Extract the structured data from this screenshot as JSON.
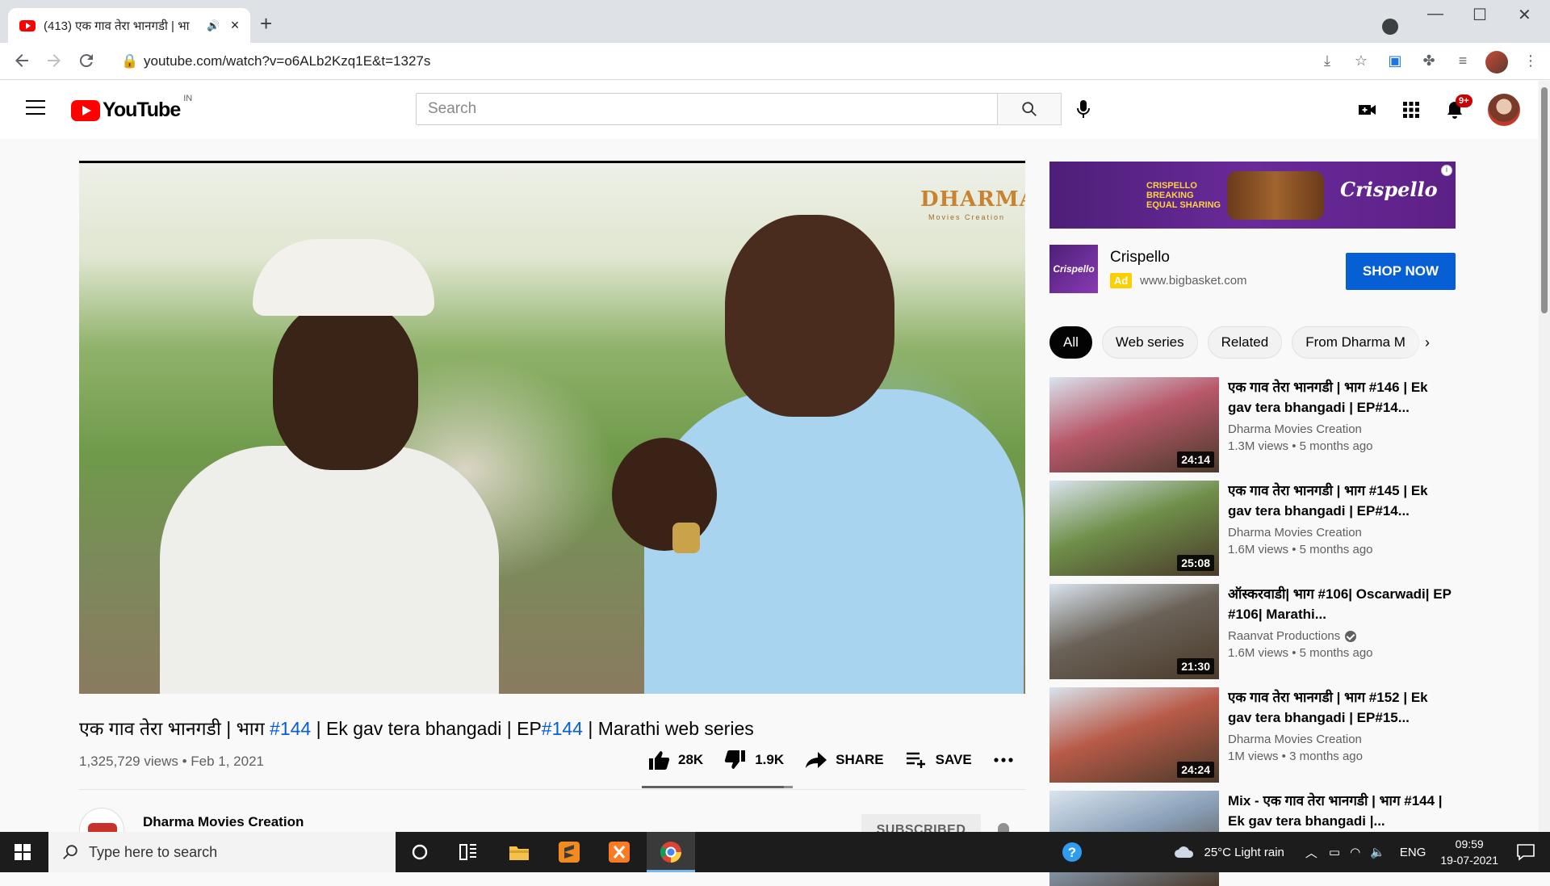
{
  "browser": {
    "tab_title": "(413) एक गाव तेरा भानगडी | भा",
    "url": "youtube.com/watch?v=o6ALb2Kzq1E&t=1327s"
  },
  "youtube": {
    "country_code": "IN",
    "search_placeholder": "Search",
    "notification_count": "9+"
  },
  "video": {
    "title_parts": [
      "एक गाव तेरा भानगडी | भाग ",
      "#144",
      " | Ek gav tera bhangadi | EP",
      "#144",
      " | Marathi web series"
    ],
    "meta": "1,325,729 views • Feb 1, 2021",
    "likes": "28K",
    "dislikes": "1.9K",
    "like_fraction": 0.94,
    "share_label": "SHARE",
    "save_label": "SAVE",
    "watermark": "DHARMA",
    "watermark_sub": "Movies Creation",
    "channel_name": "Dharma Movies Creation",
    "subscribe_label": "SUBSCRIBED"
  },
  "ad": {
    "banner_tagline": "CRISPELLO BREAKING EQUAL SHARING",
    "banner_brand": "Crispello",
    "name": "Crispello",
    "badge": "Ad",
    "url": "www.bigbasket.com",
    "cta": "SHOP NOW"
  },
  "chips": [
    "All",
    "Web series",
    "Related",
    "From Dharma M"
  ],
  "recommendations": [
    {
      "title": "एक गाव तेरा भानगडी | भाग #146 | Ek gav tera bhangadi | EP#14...",
      "channel": "Dharma Movies Creation",
      "verified": false,
      "views": "1.3M views • 5 months ago",
      "duration": "24:14",
      "color": "#b8586a"
    },
    {
      "title": "एक गाव तेरा भानगडी | भाग #145 | Ek gav tera bhangadi | EP#14...",
      "channel": "Dharma Movies Creation",
      "verified": false,
      "views": "1.6M views • 5 months ago",
      "duration": "25:08",
      "color": "#6f8f4a"
    },
    {
      "title": "ऑस्करवाडी| भाग #106| Oscarwadi| EP #106| Marathi...",
      "channel": "Raanvat Productions",
      "verified": true,
      "views": "1.6M views • 5 months ago",
      "duration": "21:30",
      "color": "#6a6258"
    },
    {
      "title": "एक गाव तेरा भानगडी | भाग #152 | Ek gav tera bhangadi | EP#15...",
      "channel": "Dharma Movies Creation",
      "verified": false,
      "views": "1M views • 3 months ago",
      "duration": "24:24",
      "color": "#b85a48"
    },
    {
      "title": "Mix - एक गाव तेरा भानगडी | भाग #144 | Ek gav tera bhangadi |...",
      "channel": "",
      "verified": false,
      "views": "",
      "duration": "",
      "color": "#8aa0b8"
    }
  ],
  "taskbar": {
    "search_placeholder": "Type here to search",
    "weather": "25°C  Light rain",
    "language": "ENG",
    "time": "09:59",
    "date": "19-07-2021"
  }
}
